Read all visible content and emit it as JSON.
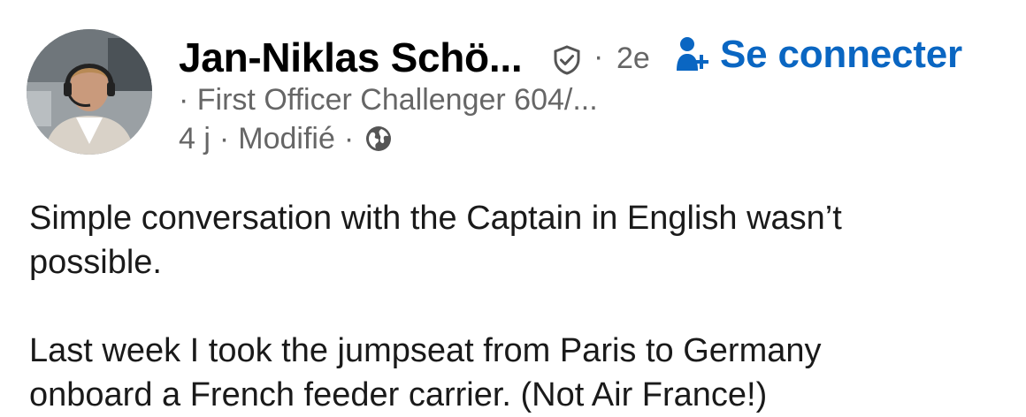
{
  "author": {
    "name": "Jan-Niklas Schö...",
    "degree": "2e",
    "headline": "First Officer Challenger 604/...",
    "avatar_icon": "profile-photo-pilot-with-headset",
    "verified_icon": "shield-check-icon"
  },
  "connect": {
    "label": "Se connecter",
    "icon": "add-person-icon"
  },
  "meta": {
    "time": "4 j",
    "edited": "Modifié",
    "visibility_icon": "globe-icon"
  },
  "post": {
    "paragraph_1": "Simple conversation with the Captain in English wasn’t",
    "paragraph_1_cont": "possible.",
    "paragraph_2": "Last week I took the jumpseat from Paris to Germany",
    "paragraph_2_cont": "onboard a French feeder carrier. (Not Air France!)"
  },
  "colors": {
    "accent": "#0a66c2",
    "secondary_text": "#666666",
    "primary_text": "#000000"
  }
}
